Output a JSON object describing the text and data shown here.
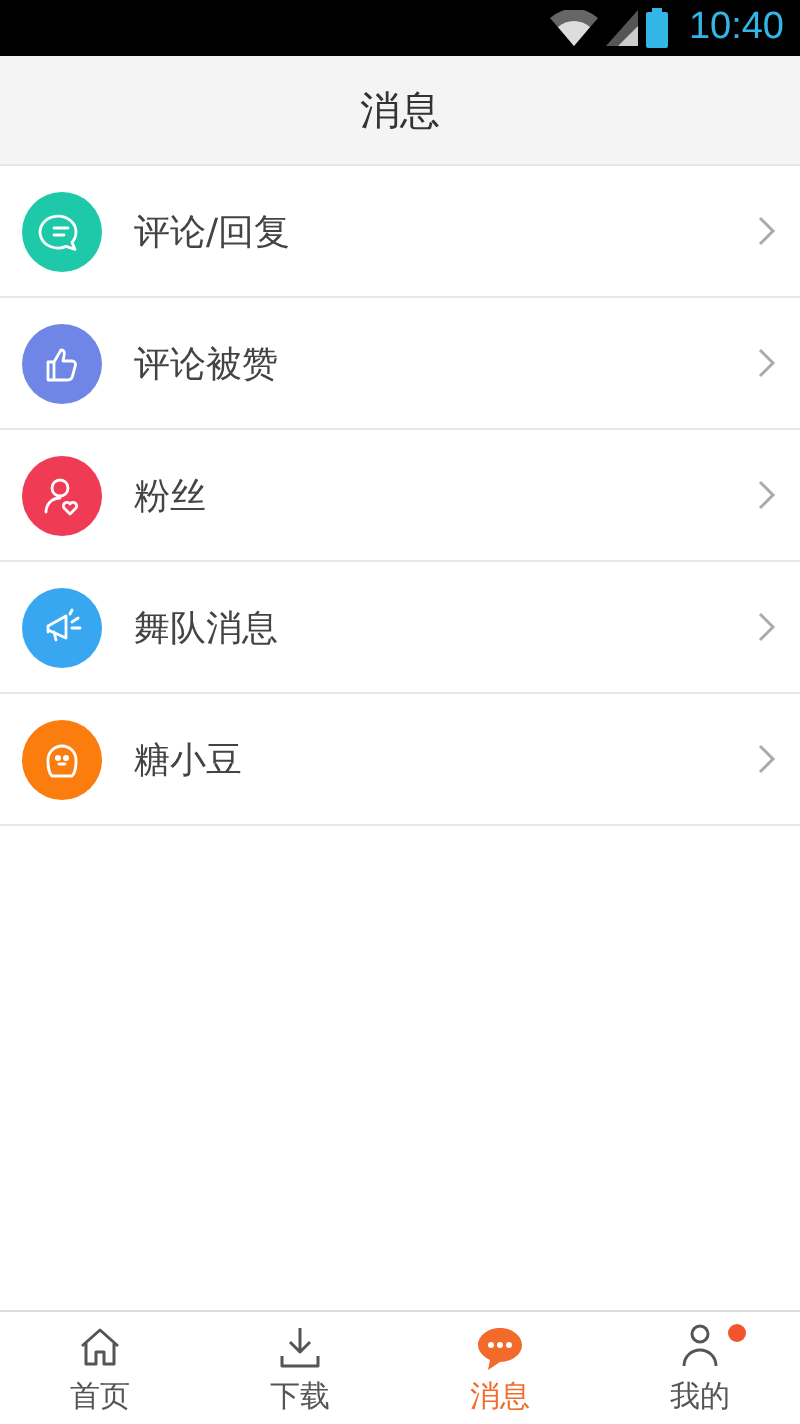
{
  "status_bar": {
    "time": "10:40"
  },
  "header": {
    "title": "消息"
  },
  "items": [
    {
      "label": "评论/回复",
      "color": "#1dc9a8"
    },
    {
      "label": "评论被赞",
      "color": "#6f86e6"
    },
    {
      "label": "粉丝",
      "color": "#ef3b54"
    },
    {
      "label": "舞队消息",
      "color": "#39a6f2"
    },
    {
      "label": "糖小豆",
      "color": "#fb7d0d"
    }
  ],
  "tabs": [
    {
      "label": "首页",
      "selected": false,
      "unread": false
    },
    {
      "label": "下载",
      "selected": false,
      "unread": false
    },
    {
      "label": "消息",
      "selected": true,
      "unread": false
    },
    {
      "label": "我的",
      "selected": false,
      "unread": true
    }
  ]
}
